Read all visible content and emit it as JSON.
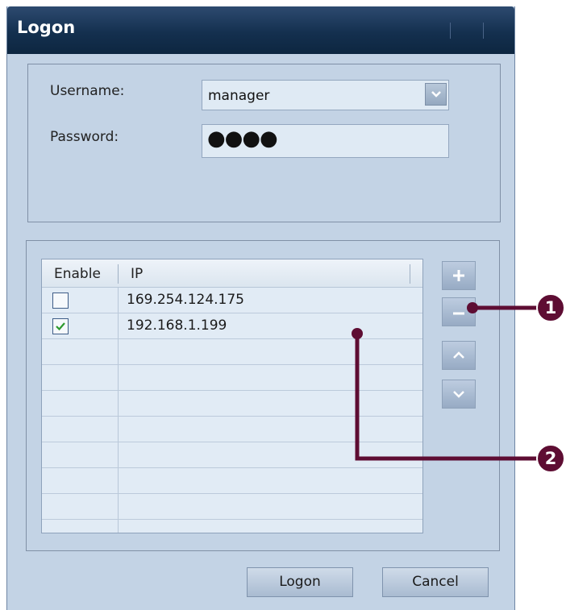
{
  "window": {
    "title": "Logon"
  },
  "login": {
    "username_label": "Username:",
    "username_value": "manager",
    "password_label": "Password:",
    "password_mask": "●●●●"
  },
  "ip_table": {
    "headers": [
      "Enable",
      "IP"
    ],
    "rows": [
      {
        "enabled": false,
        "ip": "169.254.124.175"
      },
      {
        "enabled": true,
        "ip": "192.168.1.199"
      }
    ]
  },
  "side_buttons": [
    "add-icon",
    "remove-icon",
    "move-up-icon",
    "move-down-icon"
  ],
  "buttons": {
    "logon": "Logon",
    "cancel": "Cancel"
  },
  "callouts": [
    "1",
    "2"
  ],
  "colors": {
    "callout": "#5e0d33",
    "titlebar": "#14304f",
    "panel": "#c3d3e5"
  }
}
